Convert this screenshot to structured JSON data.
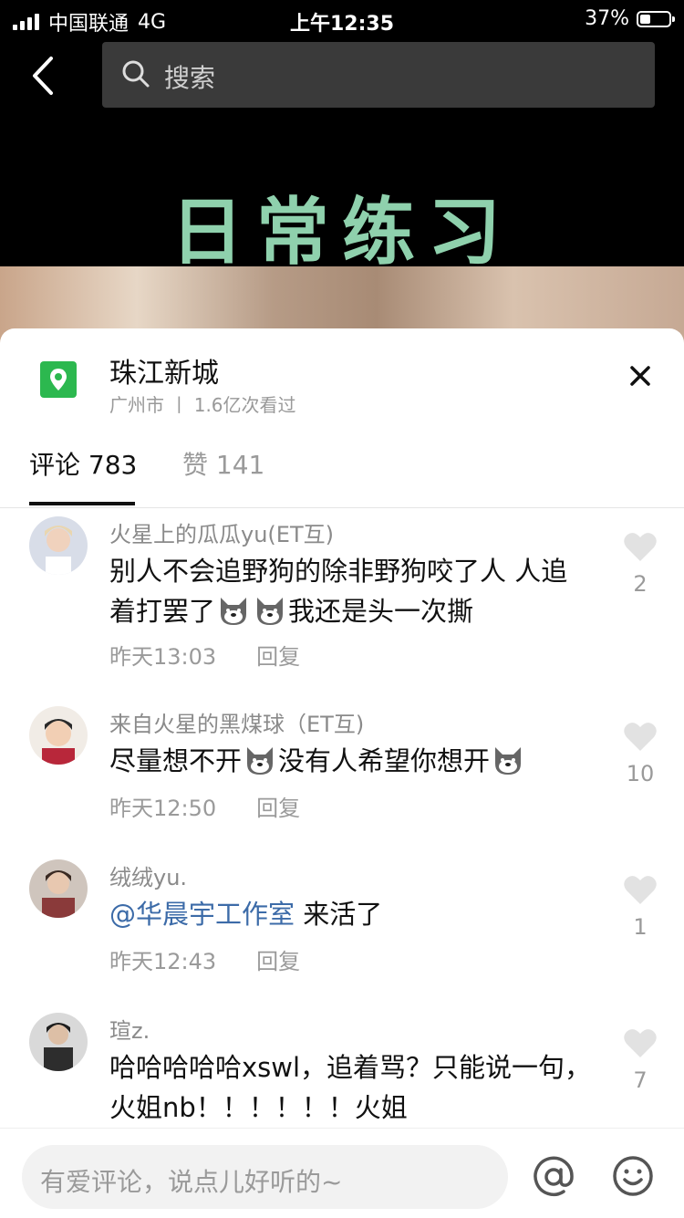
{
  "status_bar": {
    "carrier": "中国联通",
    "network": "4G",
    "time": "上午12:35",
    "battery": "37%",
    "battery_level": 0.37
  },
  "header": {
    "search_placeholder": "搜索"
  },
  "video": {
    "title": "日常练习"
  },
  "location": {
    "name": "珠江新城",
    "subtitle": "广州市 丨 1.6亿次看过"
  },
  "tabs": [
    {
      "label": "评论 783"
    },
    {
      "label": "赞 141"
    }
  ],
  "comments": [
    {
      "user": "火星上的瓜瓜yu(ET互)",
      "text_1": "别人不会追野狗的除非野狗咬了人 人追着打罢了",
      "text_2": "我还是头一次撕",
      "time": "昨天13:03",
      "reply": "回复",
      "likes": "2"
    },
    {
      "user": "来自火星的黑煤球（ET互)",
      "text_1": "尽量想不开",
      "text_2": "没有人希望你想开",
      "time": "昨天12:50",
      "reply": "回复",
      "likes": "10"
    },
    {
      "user": "绒绒yu.",
      "mention": "@华晨宇工作室",
      "text_1": " 来活了",
      "time": "昨天12:43",
      "reply": "回复",
      "likes": "1"
    },
    {
      "user": "瑄z.",
      "text_1": "哈哈哈哈哈xswl，追着骂？只能说一句，火姐nb！！！！！！火姐",
      "likes": "7"
    }
  ],
  "input": {
    "placeholder": "有爱评论，说点儿好听的~"
  },
  "colors": {
    "location_green": "#2cb84f",
    "mention_blue": "#3c6ba8",
    "video_title_green": "#8fd1ad"
  }
}
